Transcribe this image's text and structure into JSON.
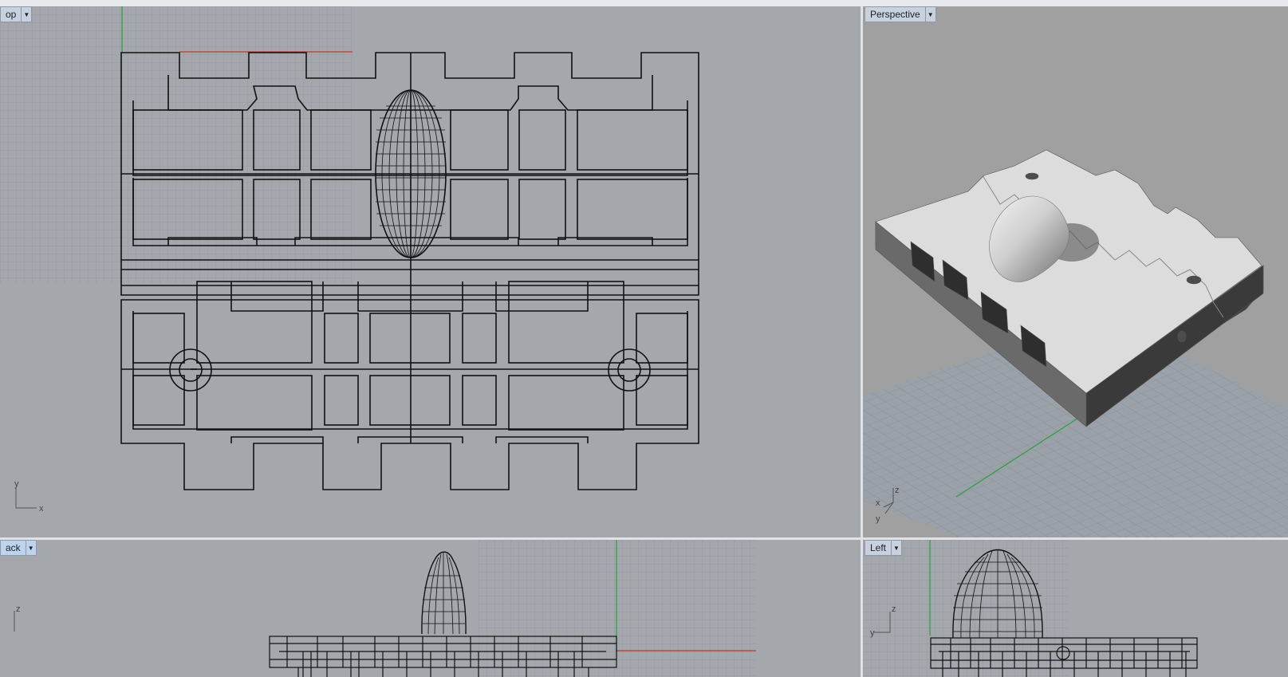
{
  "viewports": {
    "top": {
      "label": "op"
    },
    "perspective": {
      "label": "Perspective"
    },
    "back": {
      "label": "ack"
    },
    "left": {
      "label": "Left"
    }
  },
  "axes": {
    "top": {
      "a": "y",
      "b": "x"
    },
    "perspective": {
      "a": "z",
      "b": "x",
      "c": "y"
    },
    "back": {
      "a": "z"
    },
    "left": {
      "a": "z",
      "b": "y"
    }
  },
  "colors": {
    "viewport_bg": "#a4a7ac",
    "grid_line": "#8d9298",
    "x_axis": "#c0392b",
    "y_axis": "#27a23a",
    "wire": "#111111"
  },
  "icons": {
    "dropdown": "chevron-down-icon"
  }
}
